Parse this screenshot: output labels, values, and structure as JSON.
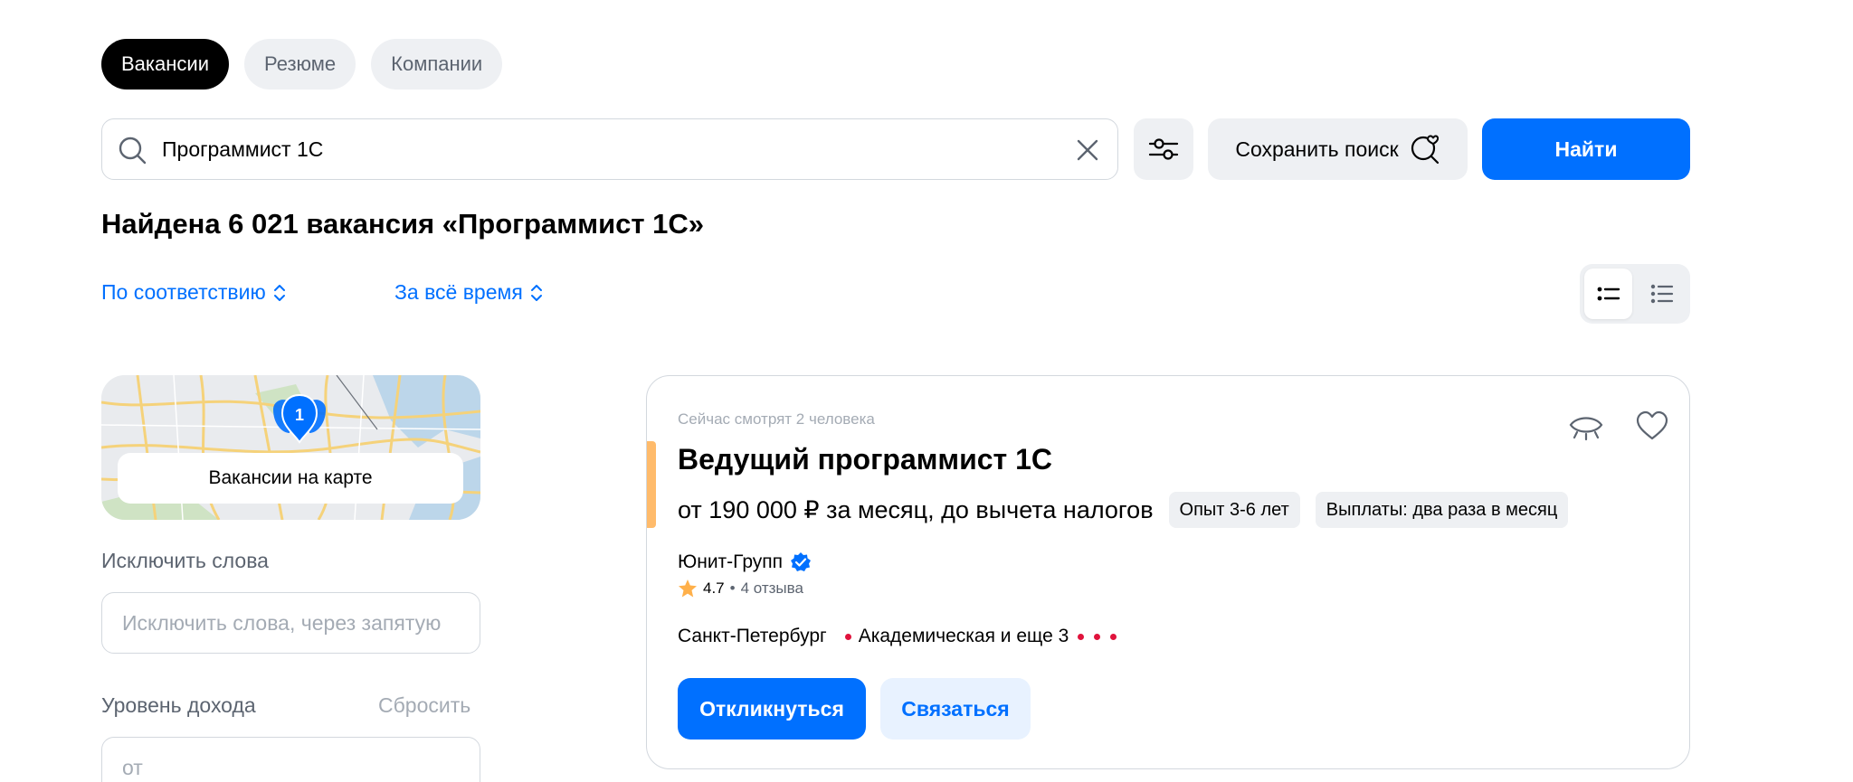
{
  "tabs": [
    {
      "label": "Вакансии",
      "active": true
    },
    {
      "label": "Резюме",
      "active": false
    },
    {
      "label": "Компании",
      "active": false
    }
  ],
  "search": {
    "value": "Программист 1С",
    "save_label": "Сохранить поиск",
    "find_label": "Найти"
  },
  "results": {
    "title": "Найдена 6 021 вакансия «Программист 1С»"
  },
  "sort": {
    "relevance": "По соответствию",
    "period": "За всё время"
  },
  "map": {
    "pin_count": "1",
    "button_label": "Вакансии на карте"
  },
  "filters": {
    "exclude_label": "Исключить слова",
    "exclude_placeholder": "Исключить слова, через запятую",
    "income_label": "Уровень дохода",
    "reset_label": "Сбросить",
    "income_from_placeholder": "от"
  },
  "vacancy": {
    "watchers": "Сейчас смотрят 2 человека",
    "title": "Ведущий программист 1С",
    "salary": "от 190 000 ₽ за месяц, до вычета налогов",
    "chips": [
      "Опыт 3-6 лет",
      "Выплаты: два раза в месяц"
    ],
    "company": "Юнит-Групп",
    "rating": "4.7",
    "reviews": "4 отзыва",
    "city": "Санкт-Петербург",
    "metro": "Академическая и еще 3",
    "apply_label": "Откликнуться",
    "contact_label": "Связаться"
  },
  "colors": {
    "primary": "#0070ff",
    "accent_bar": "#ffbb6b",
    "metro": "#e0133c",
    "verified": "#0070ff",
    "star": "#ffb04a"
  }
}
